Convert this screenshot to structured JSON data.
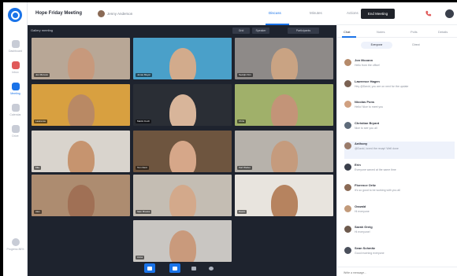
{
  "header": {
    "title": "Hope Friday Meeting",
    "host_name": "Jenny Anderson",
    "tabs": [
      "Discuss",
      "Minutes",
      "Actions"
    ],
    "end_button": "End Meeting"
  },
  "rail": {
    "items": [
      "Dashboard",
      "Inbox",
      "Meeting",
      "Calendar",
      "Drive"
    ],
    "bottom": "Progress 86%"
  },
  "stage": {
    "view_label": "Gallery meeting",
    "grid_button": "Grid",
    "speaker_button": "Speaker",
    "list_button": "Participants",
    "participants": [
      {
        "name": "Jon Mccann",
        "bg": "#b8a796",
        "skin": "#c7997c"
      },
      {
        "name": "Jonas Meyer",
        "bg": "#4aa0c9",
        "skin": "#d2ab8c"
      },
      {
        "name": "Seokjin Kim",
        "bg": "#8e8a88",
        "skin": "#c9a383"
      },
      {
        "name": "Lawrence",
        "bg": "#d8a040",
        "skin": "#b98964"
      },
      {
        "name": "Martin Koch",
        "bg": "#2a2e35",
        "skin": "#d8b59a"
      },
      {
        "name": "Chris",
        "bg": "#a0b06a",
        "skin": "#c39478"
      },
      {
        "name": "Mia",
        "bg": "#d9d4cd",
        "skin": "#c6946f"
      },
      {
        "name": "Tom Reid",
        "bg": "#6e553f",
        "skin": "#d6a789"
      },
      {
        "name": "Karl Weber",
        "bg": "#b7b2ab",
        "skin": "#c59b7d"
      },
      {
        "name": "Alex",
        "bg": "#ad8c70",
        "skin": "#a07055"
      },
      {
        "name": "Sam Brooks",
        "bg": "#c4bdb3",
        "skin": "#d3a98b"
      },
      {
        "name": "David",
        "bg": "#e8e4de",
        "skin": "#b6835f"
      },
      {
        "name": "Anna",
        "bg": "#c9c6c2",
        "skin": "#c99a7c"
      }
    ]
  },
  "panel": {
    "tabs": [
      "Chat",
      "Notes",
      "Polls",
      "Details"
    ],
    "segments": [
      "Everyone",
      "Direct"
    ],
    "compose_placeholder": "Write a message...",
    "messages": [
      {
        "name": "Jon Mccann",
        "text": "Hello from the office!",
        "color": "#b58a6a"
      },
      {
        "name": "Lawrence Hagen",
        "text": "Hey @David, you are on next for the update",
        "color": "#7a6152"
      },
      {
        "name": "Nicolas Pons",
        "text": "Hello! Nice to meet you",
        "color": "#d0a080"
      },
      {
        "name": "Christian Bryant",
        "text": "Nice to see you all",
        "color": "#5e6b7a"
      },
      {
        "name": "Anthony",
        "text": "@David, loved the recap! Well done",
        "color": "#9a7b6a"
      },
      {
        "name": "Erin",
        "text": "Everyone waved at the same time",
        "color": "#3a3f4b"
      },
      {
        "name": "Florence Ortiz",
        "text": "It's so good to be working with you all",
        "color": "#8a6a55"
      },
      {
        "name": "Oswald",
        "text": "Hi everyone",
        "color": "#c29a7a"
      },
      {
        "name": "Sarah Greig",
        "text": "Hi everyone!",
        "color": "#6d5a4d"
      },
      {
        "name": "Sean Schmitz",
        "text": "Good morning everyone",
        "color": "#4a4f5b"
      }
    ]
  }
}
